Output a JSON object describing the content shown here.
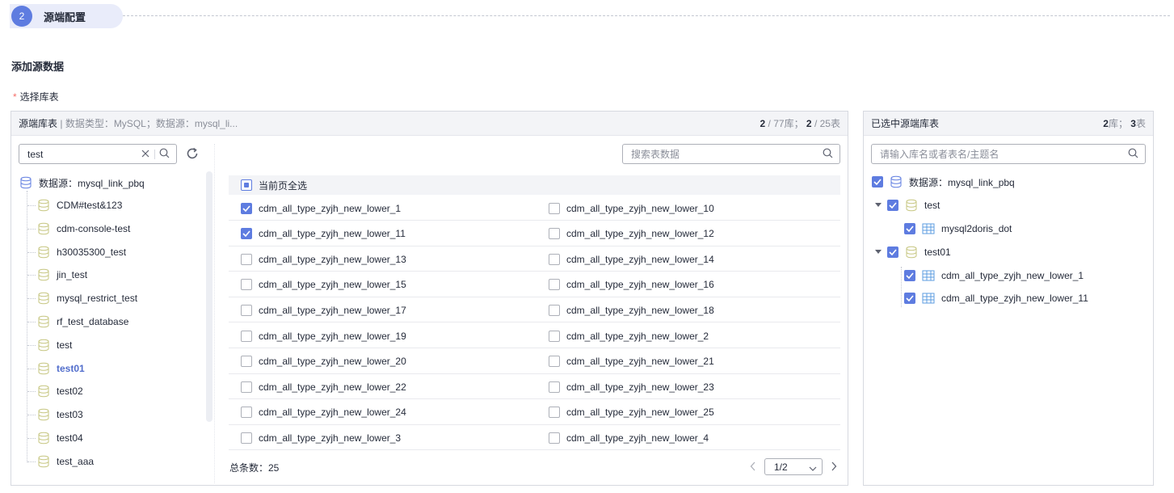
{
  "step": {
    "number": "2",
    "title": "源端配置"
  },
  "section_title": "添加源数据",
  "required_label": "选择库表",
  "left_panel": {
    "header_title": "源端库表",
    "header_meta": "数据类型：MySQL；数据源：mysql_li...",
    "db_selected": "2",
    "db_total": "77",
    "db_unit": "库；",
    "table_selected": "2",
    "table_total": "25",
    "table_unit": "表",
    "search_value": "test",
    "tree_root": "数据源：mysql_link_pbq",
    "databases": [
      {
        "name": "CDM#test&123",
        "active": false
      },
      {
        "name": "cdm-console-test",
        "active": false
      },
      {
        "name": "h30035300_test",
        "active": false
      },
      {
        "name": "jin_test",
        "active": false
      },
      {
        "name": "mysql_restrict_test",
        "active": false
      },
      {
        "name": "rf_test_database",
        "active": false
      },
      {
        "name": "test",
        "active": false
      },
      {
        "name": "test01",
        "active": true
      },
      {
        "name": "test02",
        "active": false
      },
      {
        "name": "test03",
        "active": false
      },
      {
        "name": "test04",
        "active": false
      },
      {
        "name": "test_aaa",
        "active": false
      }
    ],
    "table_search_placeholder": "搜索表数据",
    "select_all_label": "当前页全选",
    "rows": [
      [
        {
          "name": "cdm_all_type_zyjh_new_lower_1",
          "checked": true
        },
        {
          "name": "cdm_all_type_zyjh_new_lower_10",
          "checked": false
        }
      ],
      [
        {
          "name": "cdm_all_type_zyjh_new_lower_11",
          "checked": true
        },
        {
          "name": "cdm_all_type_zyjh_new_lower_12",
          "checked": false
        }
      ],
      [
        {
          "name": "cdm_all_type_zyjh_new_lower_13",
          "checked": false
        },
        {
          "name": "cdm_all_type_zyjh_new_lower_14",
          "checked": false
        }
      ],
      [
        {
          "name": "cdm_all_type_zyjh_new_lower_15",
          "checked": false
        },
        {
          "name": "cdm_all_type_zyjh_new_lower_16",
          "checked": false
        }
      ],
      [
        {
          "name": "cdm_all_type_zyjh_new_lower_17",
          "checked": false
        },
        {
          "name": "cdm_all_type_zyjh_new_lower_18",
          "checked": false
        }
      ],
      [
        {
          "name": "cdm_all_type_zyjh_new_lower_19",
          "checked": false
        },
        {
          "name": "cdm_all_type_zyjh_new_lower_2",
          "checked": false
        }
      ],
      [
        {
          "name": "cdm_all_type_zyjh_new_lower_20",
          "checked": false
        },
        {
          "name": "cdm_all_type_zyjh_new_lower_21",
          "checked": false
        }
      ],
      [
        {
          "name": "cdm_all_type_zyjh_new_lower_22",
          "checked": false
        },
        {
          "name": "cdm_all_type_zyjh_new_lower_23",
          "checked": false
        }
      ],
      [
        {
          "name": "cdm_all_type_zyjh_new_lower_24",
          "checked": false
        },
        {
          "name": "cdm_all_type_zyjh_new_lower_25",
          "checked": false
        }
      ],
      [
        {
          "name": "cdm_all_type_zyjh_new_lower_3",
          "checked": false
        },
        {
          "name": "cdm_all_type_zyjh_new_lower_4",
          "checked": false
        }
      ]
    ],
    "total_label": "总条数：25",
    "page_select": "1/2"
  },
  "right_panel": {
    "header_title": "已选中源端库表",
    "db_count": "2",
    "db_unit": "库；",
    "table_count": "3",
    "table_unit": "表",
    "search_placeholder": "请输入库名或者表名/主题名",
    "root": "数据源：mysql_link_pbq",
    "groups": [
      {
        "name": "test",
        "tables": [
          "mysql2doris_dot"
        ]
      },
      {
        "name": "test01",
        "tables": [
          "cdm_all_type_zyjh_new_lower_1",
          "cdm_all_type_zyjh_new_lower_11"
        ]
      }
    ]
  },
  "colors": {
    "accent": "#5e7ce0",
    "active_text": "#526ecc",
    "required": "#f66f6a",
    "db_icon": "#c6c680"
  }
}
